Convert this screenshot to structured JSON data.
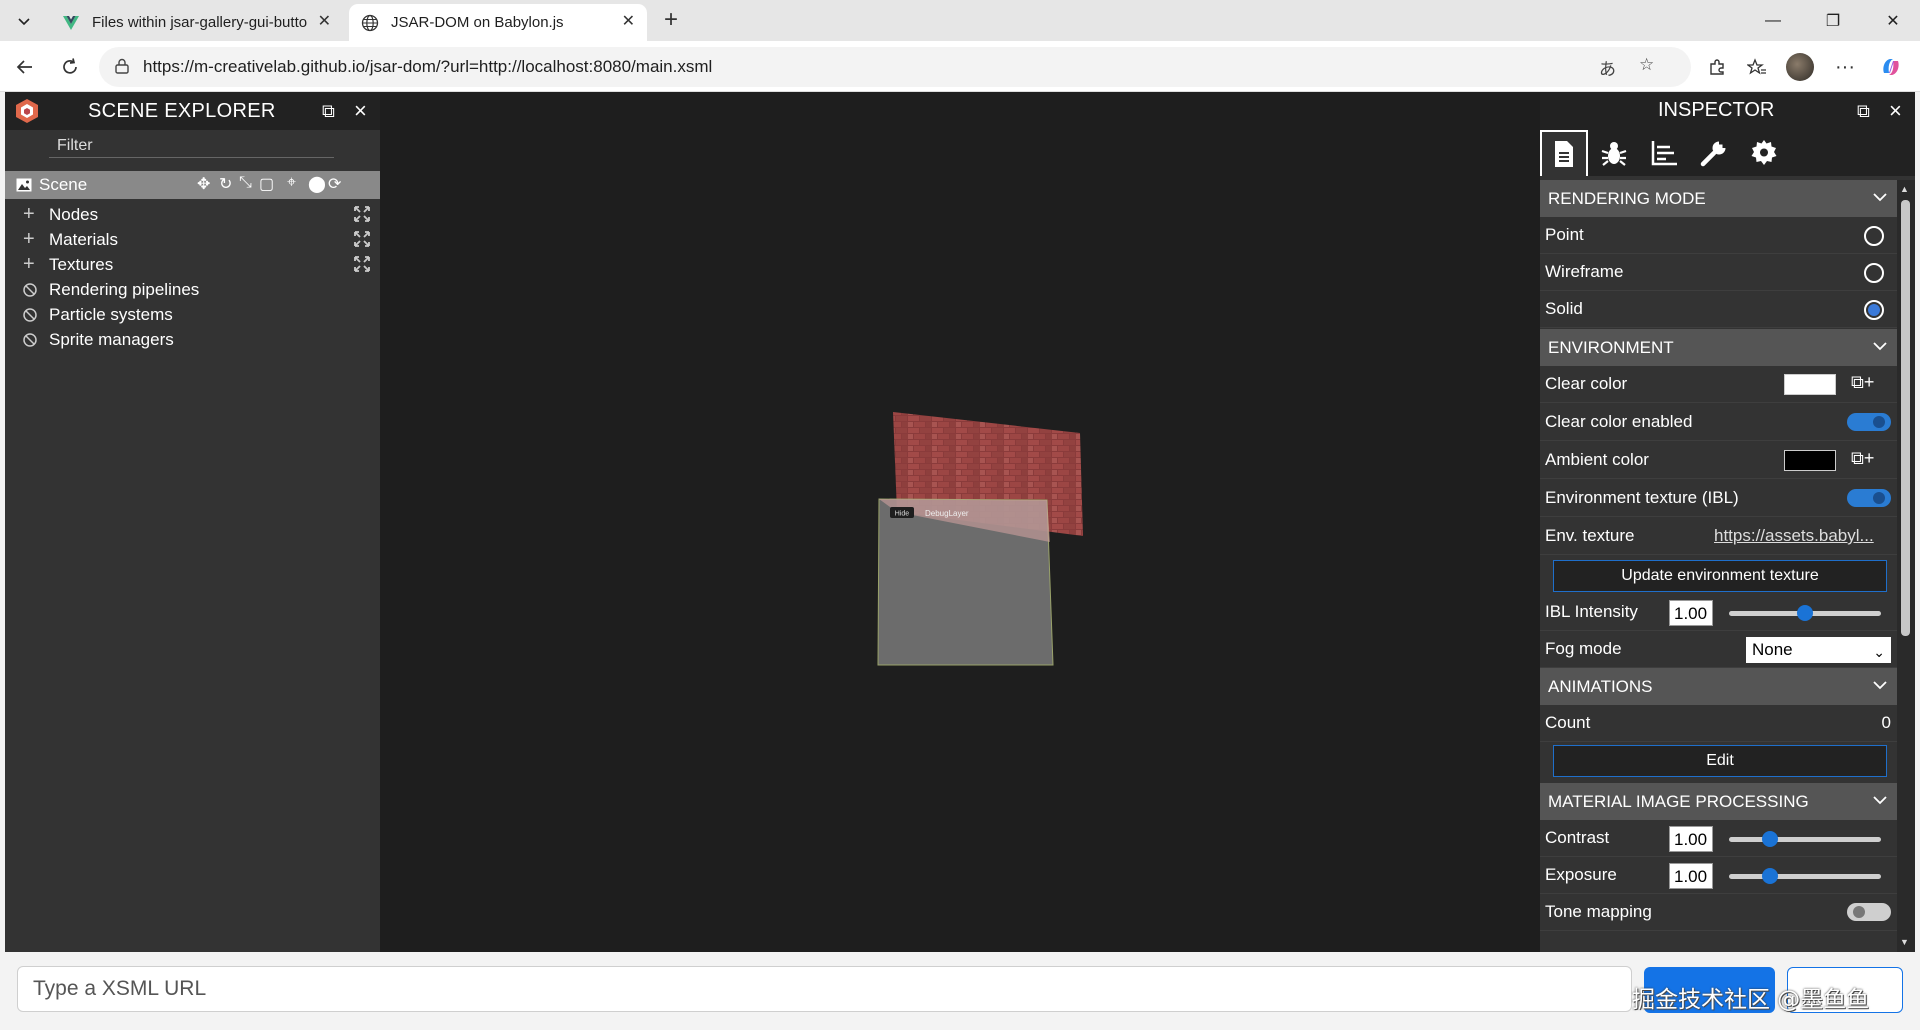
{
  "browser": {
    "tabs": [
      {
        "title": "Files within jsar-gallery-gui-butto",
        "active": false
      },
      {
        "title": "JSAR-DOM on Babylon.js",
        "active": true
      }
    ],
    "url": "https://m-creativelab.github.io/jsar-dom/?url=http://localhost:8080/main.xsml"
  },
  "explorer": {
    "title": "SCENE EXPLORER",
    "filter_placeholder": "Filter",
    "scene_label": "Scene",
    "items": [
      {
        "label": "Nodes",
        "kind": "expand"
      },
      {
        "label": "Materials",
        "kind": "expand"
      },
      {
        "label": "Textures",
        "kind": "expand"
      },
      {
        "label": "Rendering pipelines",
        "kind": "disabled"
      },
      {
        "label": "Particle systems",
        "kind": "disabled"
      },
      {
        "label": "Sprite managers",
        "kind": "disabled"
      }
    ]
  },
  "viewport": {
    "panel_button": "Hide",
    "panel_label": "DebugLayer"
  },
  "inspector": {
    "title": "INSPECTOR",
    "tab_icons": [
      "document-icon",
      "bug-icon",
      "statistics-icon",
      "wrench-icon",
      "gear-icon"
    ],
    "rendering_mode": {
      "header": "RENDERING MODE",
      "options": [
        "Point",
        "Wireframe",
        "Solid"
      ],
      "selected": "Solid"
    },
    "environment": {
      "header": "ENVIRONMENT",
      "clear_color_label": "Clear color",
      "clear_color_value": "#FFFFFF",
      "clear_color_enabled_label": "Clear color enabled",
      "clear_color_enabled": true,
      "ambient_color_label": "Ambient color",
      "ambient_color_value": "#000000",
      "env_texture_ibl_label": "Environment texture (IBL)",
      "env_texture_ibl": true,
      "env_texture_label": "Env. texture",
      "env_texture_value": "https://assets.babyl...",
      "update_button": "Update environment texture",
      "ibl_intensity_label": "IBL Intensity",
      "ibl_intensity_value": "1.00",
      "ibl_intensity_fraction": 0.5,
      "fog_mode_label": "Fog mode",
      "fog_mode_value": "None"
    },
    "animations": {
      "header": "ANIMATIONS",
      "count_label": "Count",
      "count_value": "0",
      "edit_button": "Edit"
    },
    "image_processing": {
      "header": "MATERIAL IMAGE PROCESSING",
      "contrast_label": "Contrast",
      "contrast_value": "1.00",
      "contrast_fraction": 0.27,
      "exposure_label": "Exposure",
      "exposure_value": "1.00",
      "exposure_fraction": 0.27,
      "tone_mapping_label": "Tone mapping",
      "tone_mapping": false
    }
  },
  "bottom": {
    "input_placeholder": "Type a XSML URL",
    "watermark": "掘金技术社区 @墨鱼鱼"
  },
  "colors": {
    "accent": "#1473e6",
    "panel_bg": "#333333",
    "section_bg": "#555555",
    "viewport_bg": "#1e1e1e"
  }
}
